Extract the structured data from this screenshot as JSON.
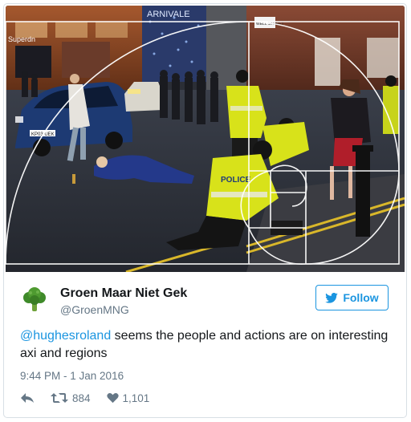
{
  "tweet": {
    "author_name": "Groen Maar Niet Gek",
    "author_handle": "@GroenMNG",
    "follow_label": "Follow",
    "mention": "@hughesroland",
    "text": " seems the people and actions are on interesting axi and regions",
    "timestamp": "9:44 PM - 1 Jan 2016",
    "retweet_count": "884",
    "like_count": "1,101"
  },
  "photo": {
    "signs": {
      "store_left": "Superdn",
      "store_top": "ARNIVALE",
      "street_sign": "WELL STREET",
      "police_vest_1": "POLICE",
      "police_vest_2": "POLICE",
      "taxi_plate": "KP03 UEK"
    }
  },
  "colors": {
    "link": "#1b95e0",
    "text_primary": "#14171a",
    "text_secondary": "#657786",
    "border": "#d8dfe5",
    "police_vest": "#d8e21a",
    "taxi": "#1d3a73"
  },
  "icons": {
    "avatar": "broccoli-icon",
    "follow": "twitter-bird-icon",
    "reply": "reply-icon",
    "retweet": "retweet-icon",
    "like": "heart-icon"
  }
}
